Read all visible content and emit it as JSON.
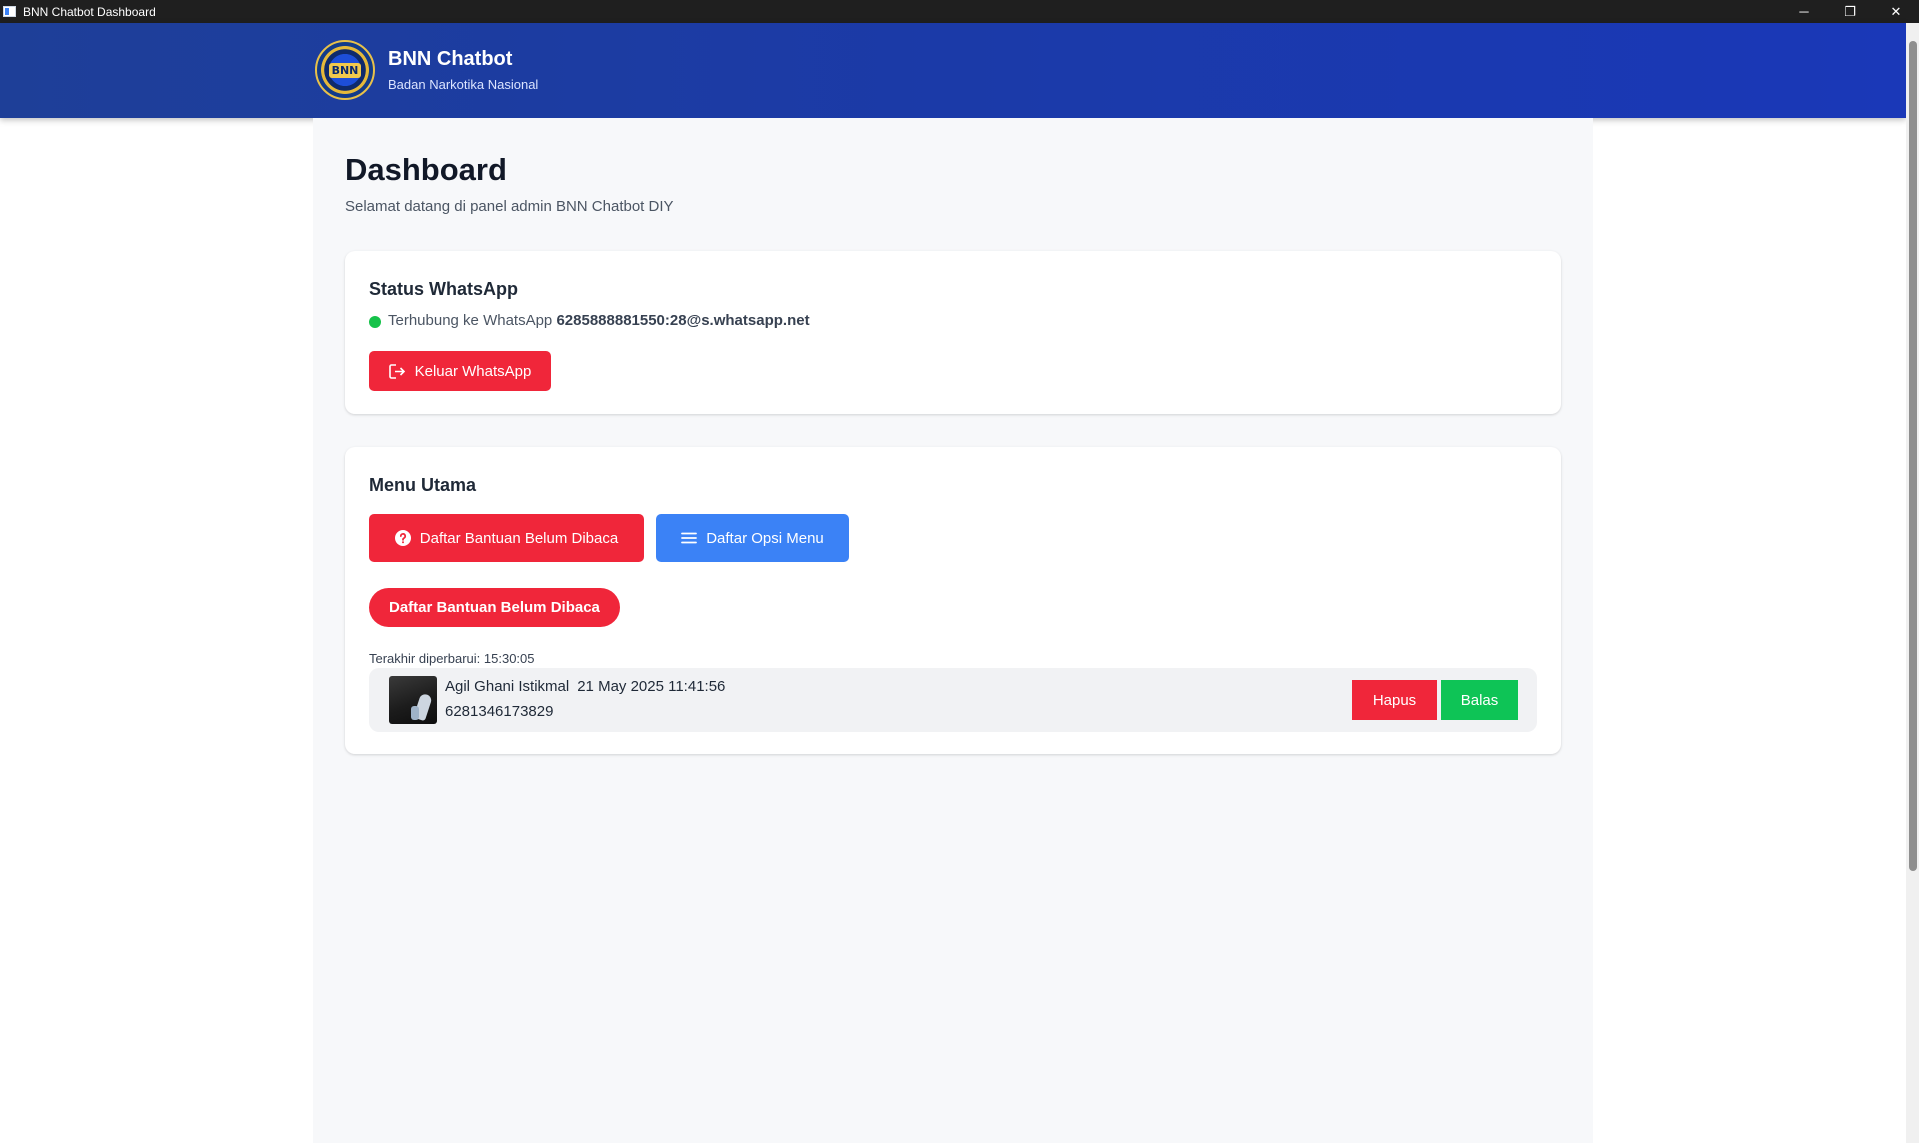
{
  "window": {
    "title": "BNN Chatbot Dashboard",
    "minimize": "─",
    "restore": "❐",
    "close": "✕"
  },
  "header": {
    "logo_text": "BNN",
    "title": "BNN Chatbot",
    "subtitle": "Badan Narkotika Nasional",
    "background": "#1b3aa8"
  },
  "page": {
    "title": "Dashboard",
    "subtitle": "Selamat datang di panel admin BNN Chatbot DIY"
  },
  "whatsapp_status": {
    "title": "Status WhatsApp",
    "status_label": "Terhubung ke WhatsApp",
    "account": "6285888881550:28@s.whatsapp.net",
    "status_color": "#16c24a",
    "logout_label": "Keluar WhatsApp",
    "logout_icon": "logout-icon"
  },
  "main_menu": {
    "title": "Menu Utama",
    "btn_help_label": "Daftar Bantuan Belum Dibaca",
    "btn_help_icon": "question-circle-icon",
    "btn_menu_label": "Daftar Opsi Menu",
    "btn_menu_icon": "menu-lines-icon",
    "section_pill": "Daftar Bantuan Belum Dibaca",
    "last_updated": "Terakhir diperbarui: 15:30:05",
    "items": [
      {
        "name": "Agil Ghani Istikmal",
        "date": "21 May 2025 11:41:56",
        "phone": "6281346173829",
        "delete_label": "Hapus",
        "reply_label": "Balas"
      }
    ]
  },
  "colors": {
    "danger": "#f0263a",
    "primary": "#3b82f6",
    "success": "#0ec456"
  }
}
